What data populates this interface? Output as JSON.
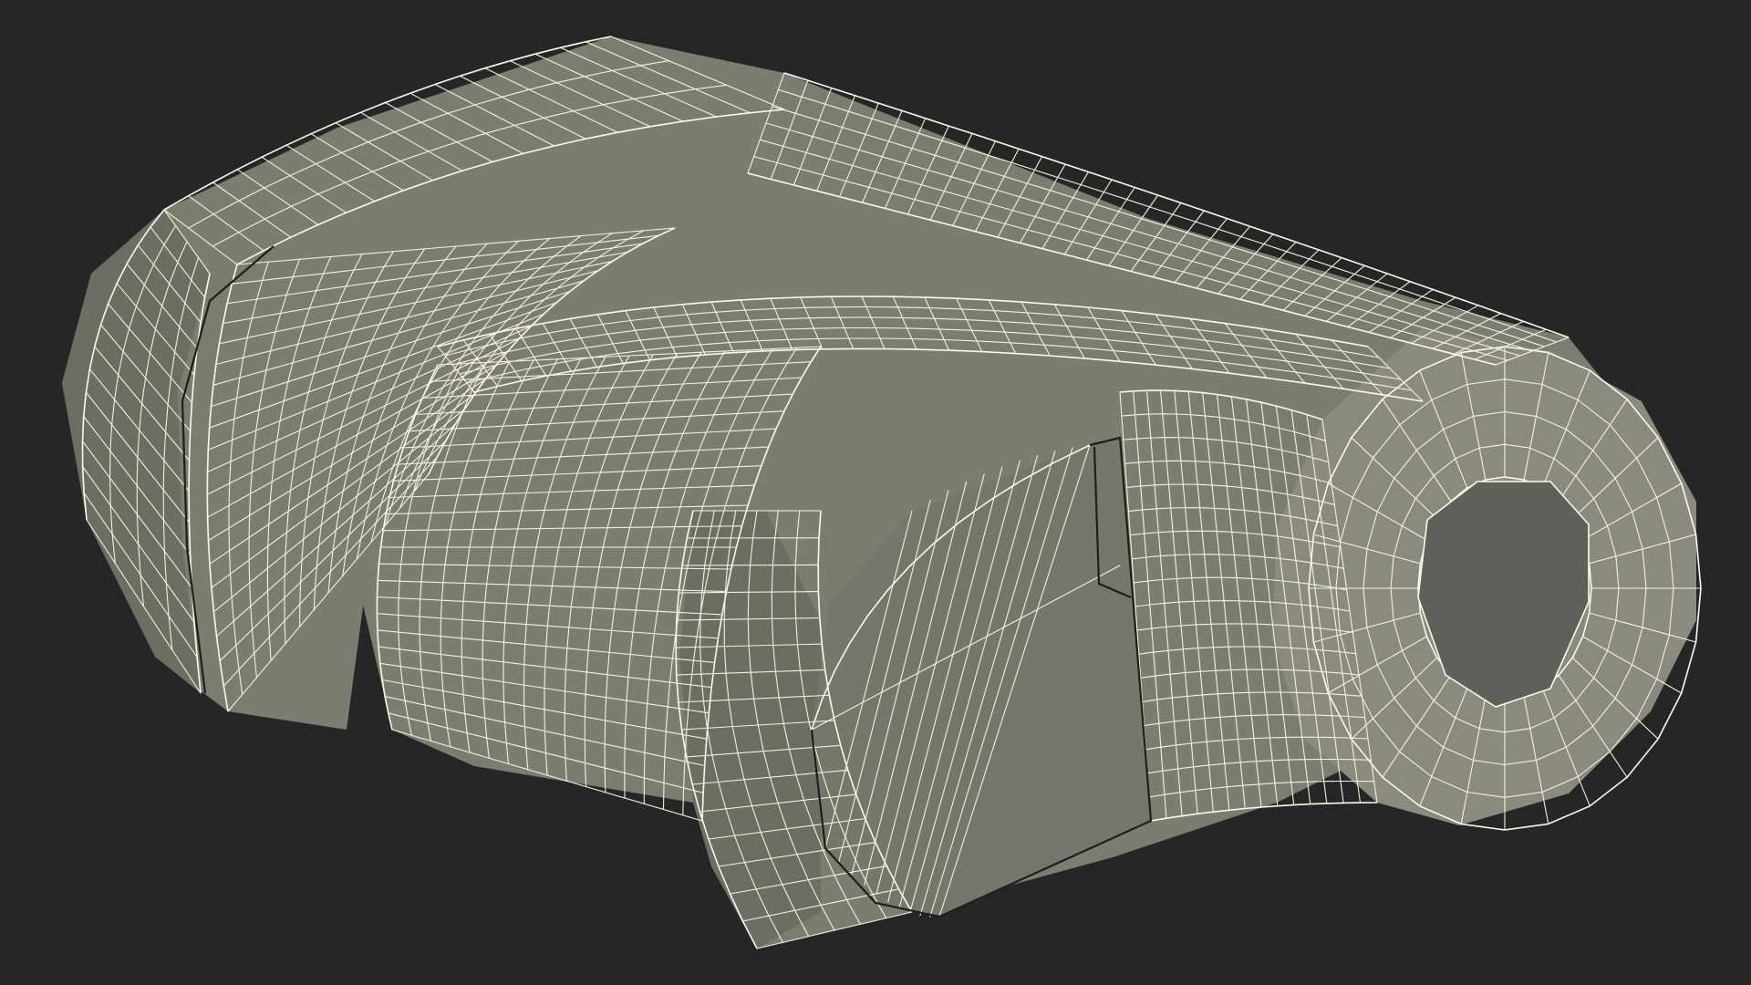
{
  "scene": {
    "background_color": "#262626",
    "object_color": "#7c7d71",
    "wireframe_color": "#f4f2dc",
    "seam_color": "#1e1e1c",
    "object": "wireframe-rangefinder-model",
    "icons": [
      "eyepiece-lens-icon"
    ]
  }
}
